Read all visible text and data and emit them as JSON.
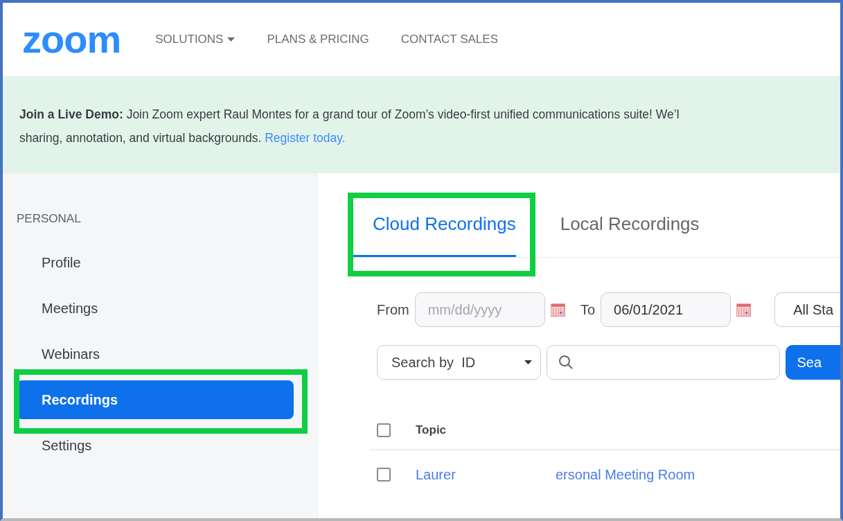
{
  "header": {
    "logo": "zoom",
    "nav": [
      {
        "label": "SOLUTIONS",
        "dropdown": true
      },
      {
        "label": "PLANS & PRICING",
        "dropdown": false
      },
      {
        "label": "CONTACT SALES",
        "dropdown": false
      }
    ]
  },
  "banner": {
    "text": "**Join a Live Demo:** Join Zoom expert Raul Montes for a grand tour of Zoom’s video-first unified communications suite! We’l",
    "text2": "sharing, annotation, and virtual backgrounds.",
    "link": "Register today."
  },
  "sidebar": {
    "section": "PERSONAL",
    "items": [
      {
        "label": "Profile",
        "selected": false,
        "highlighted": false
      },
      {
        "label": "Meetings",
        "selected": false,
        "highlighted": false
      },
      {
        "label": "Webinars",
        "selected": false,
        "highlighted": false
      },
      {
        "label": "Recordings",
        "selected": true,
        "highlighted": true
      },
      {
        "label": "Settings",
        "selected": false,
        "highlighted": false
      }
    ]
  },
  "tabs": [
    {
      "label": "Cloud Recordings",
      "selected": true,
      "highlighted": true
    },
    {
      "label": "Local Recordings",
      "selected": false,
      "highlighted": false
    }
  ],
  "filters": {
    "from_label": "From",
    "from": {
      "placeholder": "mm/dd/yyyy"
    },
    "to_label": "To",
    "to": {
      "value": "06/01/2021"
    },
    "status": "All Sta",
    "search_by": "Search by  ID",
    "search_button": "Sea"
  },
  "table": {
    "select_all": {
      "checked": false
    },
    "columns": [
      "Topic"
    ],
    "rows": [
      {
        "checked": false,
        "topic": "Laurer",
        "column_2": "ersonal Meeting Room"
      }
    ]
  }
}
